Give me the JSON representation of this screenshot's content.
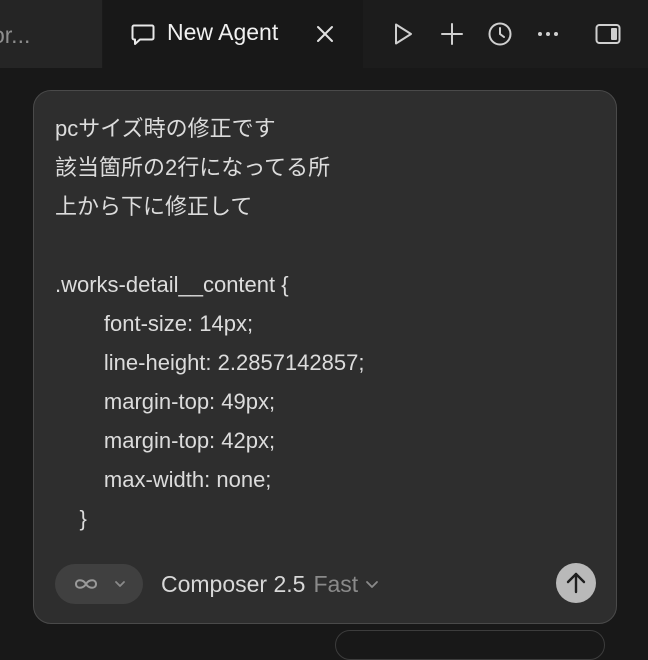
{
  "tabs": {
    "previous_label": "or...",
    "active_label": "New Agent"
  },
  "icons": {
    "chat": "chat-bubble-icon",
    "close": "close-icon",
    "run": "play-icon",
    "add": "plus-icon",
    "history": "clock-icon",
    "more": "more-icon",
    "panel": "sidebar-toggle-icon",
    "mode": "infinity-icon",
    "send": "arrow-up-icon"
  },
  "composer": {
    "prompt": "pcサイズ時の修正です\n該当箇所の2行になってる所\n上から下に修正して\n\n.works-detail__content {\n        font-size: 14px;\n        line-height: 2.2857142857;\n        margin-top: 49px;\n        margin-top: 42px;\n        max-width: none;\n    }",
    "model_name": "Composer 2.5",
    "model_speed": "Fast"
  },
  "colors": {
    "background": "#181818",
    "composer_bg": "#2e2e2e",
    "send_button": "#b9b9b9"
  }
}
